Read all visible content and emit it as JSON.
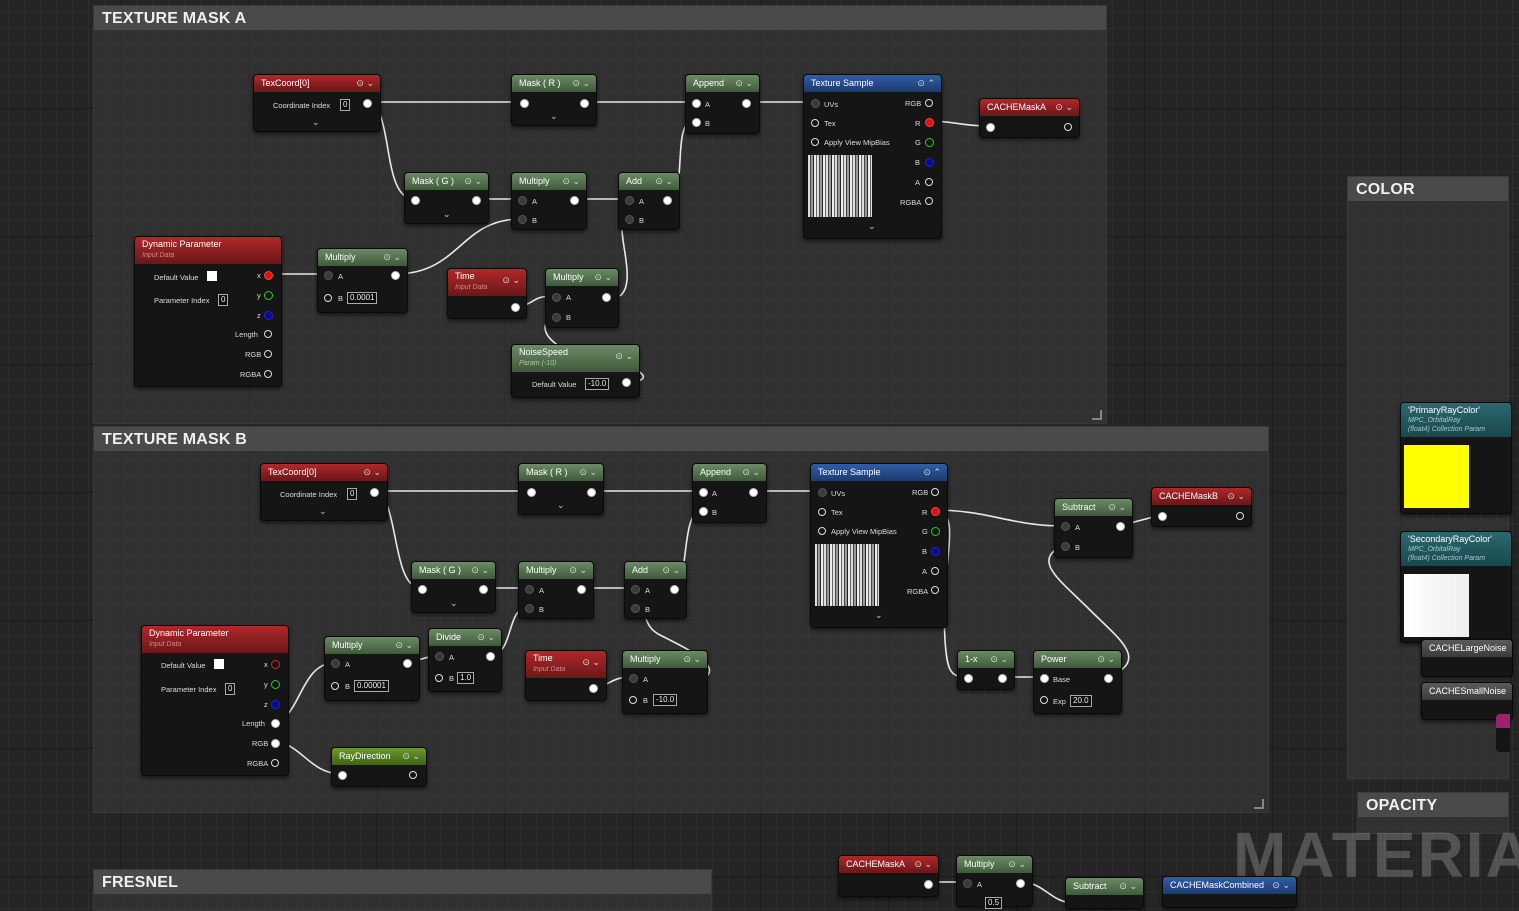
{
  "comments": {
    "a": "TEXTURE MASK A",
    "b": "TEXTURE MASK B",
    "fresnel": "FRESNEL",
    "color": "COLOR",
    "opacity": "OPACITY"
  },
  "watermark": "MATERIAL",
  "labels": {
    "texcoord": "TexCoord[0]",
    "coord_index": "Coordinate Index",
    "zero": "0",
    "mask_r": "Mask ( R )",
    "mask_g": "Mask ( G )",
    "append": "Append",
    "multiply": "Multiply",
    "add": "Add",
    "subtract": "Subtract",
    "divide": "Divide",
    "power": "Power",
    "one_minus_x": "1-x",
    "texture_sample": "Texture Sample",
    "uvs": "UVs",
    "tex": "Tex",
    "apply_view_mip": "Apply View MipBias",
    "rgb": "RGB",
    "rgba": "RGBA",
    "r": "R",
    "g": "G",
    "b": "B",
    "a": "A",
    "x": "x",
    "y": "y",
    "z": "z",
    "length": "Length",
    "dyn_param": "Dynamic Parameter",
    "input_data": "Input Data",
    "default_value": "Default Value",
    "param_index": "Parameter Index",
    "time": "Time",
    "noise_speed": "NoiseSpeed",
    "noise_speed_sub": "Param (-10)",
    "base": "Base",
    "exp": "Exp",
    "ray_direction": "RayDirection",
    "cache_mask_a": "CACHEMaskA",
    "cache_mask_b": "CACHEMaskB",
    "cache_mask_combined": "CACHEMaskCombined",
    "cache_large_noise": "CACHELargeNoise",
    "cache_small_noise": "CACHESmallNoise",
    "primary_ray_color": "'PrimaryRayColor'",
    "secondary_ray_color": "'SecondaryRayColor'",
    "mpc_sub": "MPC_OrbitalRay",
    "collection_param": "(float4) Collection Param"
  },
  "values": {
    "mult_a_b": "0.0001",
    "noise_default": "-10.0",
    "mult_b_b": "0.00001",
    "divide_b": "1.0",
    "mult_b2_b": "-10.0",
    "power_exp": "20.0",
    "bottom_mult_b": "0.5"
  },
  "colors": {
    "primary_ray": "#ffff00",
    "secondary_ray": "#ffffff"
  }
}
